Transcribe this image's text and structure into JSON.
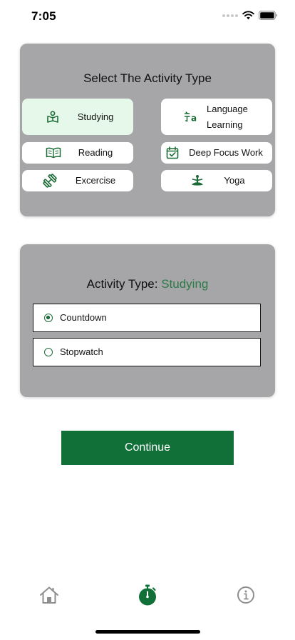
{
  "status_bar": {
    "time": "7:05",
    "icons": [
      "signal-dots-icon",
      "wifi-icon",
      "battery-icon"
    ]
  },
  "activity_panel": {
    "title": "Select The Activity Type",
    "options": [
      {
        "label": "Studying",
        "icon": "study-book-icon",
        "selected": true
      },
      {
        "label_line1": "Language",
        "label_line2": "Learning",
        "icon": "language-icon",
        "selected": false
      },
      {
        "label": "Reading",
        "icon": "open-book-icon",
        "selected": false
      },
      {
        "label": "Deep Focus Work",
        "icon": "calendar-check-icon",
        "selected": false
      },
      {
        "label": "Excercise",
        "icon": "dumbbell-icon",
        "selected": false
      },
      {
        "label": "Yoga",
        "icon": "yoga-icon",
        "selected": false
      }
    ]
  },
  "timer_panel": {
    "activity_prefix": "Activity Type:",
    "activity_value": "Studying",
    "modes": [
      {
        "label": "Countdown",
        "selected": true
      },
      {
        "label": "Stopwatch",
        "selected": false
      }
    ]
  },
  "continue_label": "Continue",
  "tab_bar": {
    "items": [
      {
        "icon": "home-icon",
        "active": false
      },
      {
        "icon": "stopwatch-icon",
        "active": true
      },
      {
        "icon": "info-icon",
        "active": false
      }
    ]
  },
  "colors": {
    "accent": "#107038",
    "accent_text": "#2c7a47",
    "panel_bg": "#a6a6a8",
    "selected_bg": "#e6f8ea",
    "inactive_icon": "#8e8e8e"
  }
}
